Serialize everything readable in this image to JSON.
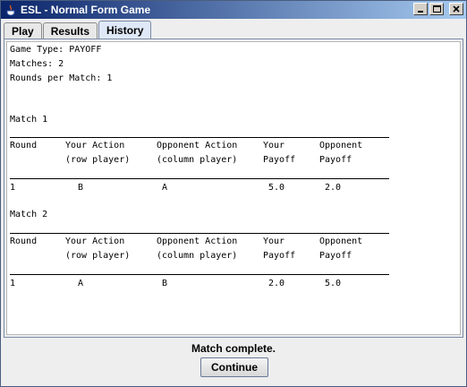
{
  "window": {
    "title": "ESL - Normal Form Game"
  },
  "tabs": [
    {
      "label": "Play",
      "active": false
    },
    {
      "label": "Results",
      "active": false
    },
    {
      "label": "History",
      "active": true
    }
  ],
  "history": {
    "game_type": "Game Type: PAYOFF",
    "matches": "Matches: 2",
    "rounds_per_match": "Rounds per Match: 1",
    "columns": {
      "round": "Round",
      "your_action_1": "Your Action",
      "your_action_2": "(row player)",
      "opp_action_1": "Opponent Action",
      "opp_action_2": "(column player)",
      "your_payoff_1": "Your",
      "your_payoff_2": "Payoff",
      "opp_payoff_1": "Opponent",
      "opp_payoff_2": "Payoff"
    },
    "match_list": [
      {
        "title": "Match 1",
        "rows": [
          {
            "round": "1",
            "your_action": "B",
            "opp_action": "A",
            "your_payoff": "5.0",
            "opp_payoff": "2.0"
          }
        ]
      },
      {
        "title": "Match 2",
        "rows": [
          {
            "round": "1",
            "your_action": "A",
            "opp_action": "B",
            "your_payoff": "2.0",
            "opp_payoff": "5.0"
          }
        ]
      }
    ]
  },
  "footer": {
    "status": "Match complete.",
    "continue_label": "Continue"
  }
}
